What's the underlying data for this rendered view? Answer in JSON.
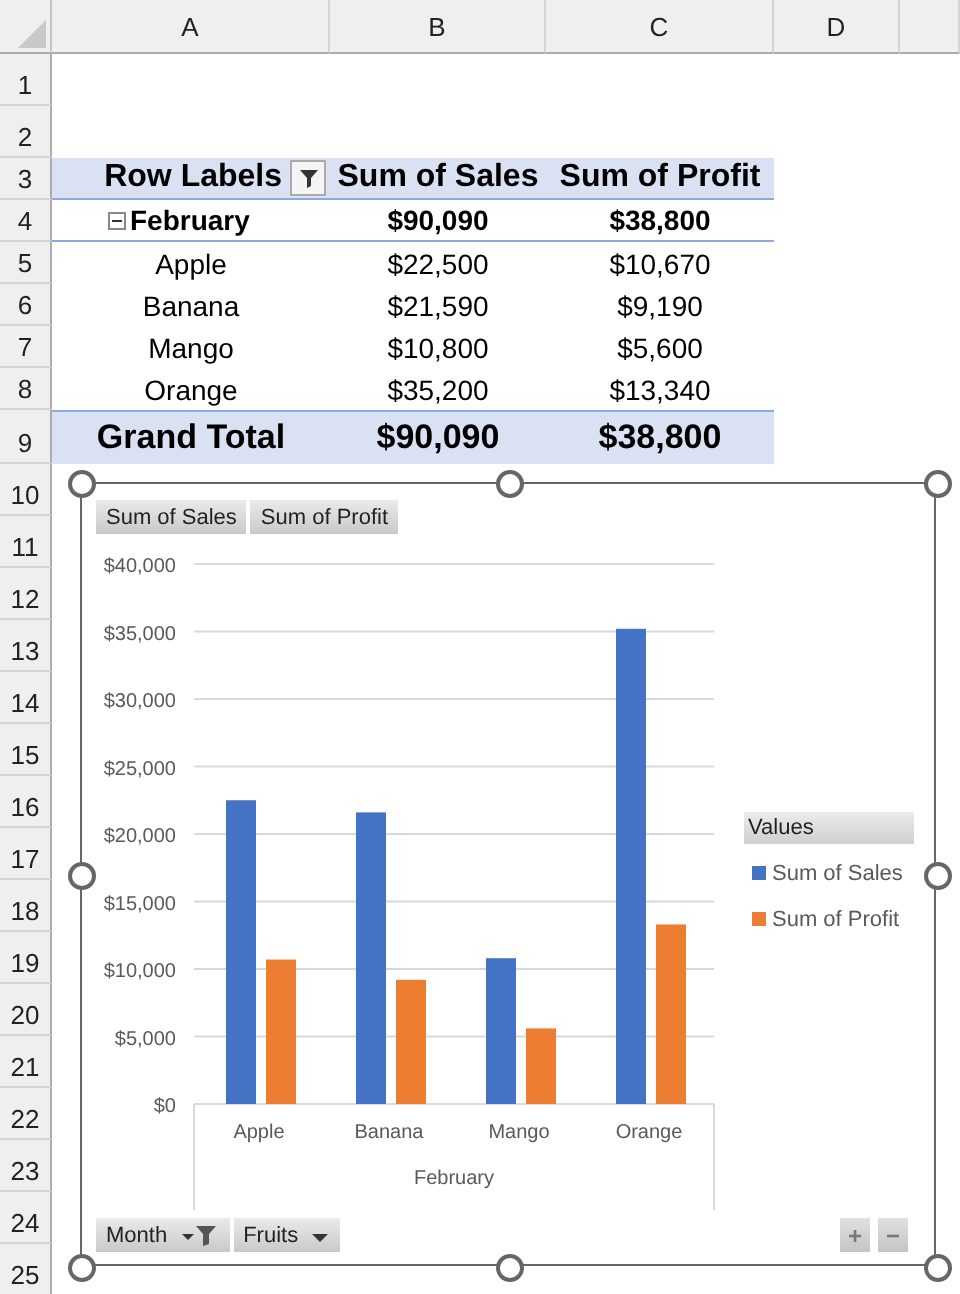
{
  "columns": [
    "A",
    "B",
    "C",
    "D"
  ],
  "rows": [
    "1",
    "2",
    "3",
    "4",
    "5",
    "6",
    "7",
    "8",
    "9",
    "10",
    "11",
    "12",
    "13",
    "14",
    "15",
    "16",
    "17",
    "18",
    "19",
    "20",
    "21",
    "22",
    "23",
    "24",
    "25"
  ],
  "pivot_table": {
    "header": {
      "row_labels": "Row Labels",
      "filtered": true,
      "col_1": "Sum of Sales",
      "col_2": "Sum of Profit"
    },
    "group": {
      "label": "February",
      "expanded": true,
      "sales": "$90,090",
      "profit": "$38,800"
    },
    "items": [
      {
        "label": "Apple",
        "sales": "$22,500",
        "profit": "$10,670"
      },
      {
        "label": "Banana",
        "sales": "$21,590",
        "profit": "$9,190"
      },
      {
        "label": "Mango",
        "sales": "$10,800",
        "profit": "$5,600"
      },
      {
        "label": "Orange",
        "sales": "$35,200",
        "profit": "$13,340"
      }
    ],
    "grand_total": {
      "label": "Grand Total",
      "sales": "$90,090",
      "profit": "$38,800"
    }
  },
  "pivot_chart": {
    "value_buttons": [
      "Sum of Sales",
      "Sum of Profit"
    ],
    "axis_buttons": [
      {
        "label": "Month",
        "filtered": true
      },
      {
        "label": "Fruits",
        "filtered": false
      }
    ],
    "legend_title": "Values",
    "zoom_buttons": [
      "+",
      "−"
    ],
    "chart_data": {
      "type": "bar",
      "xlabel": "February",
      "categories": [
        "Apple",
        "Banana",
        "Mango",
        "Orange"
      ],
      "series": [
        {
          "name": "Sum of Sales",
          "color": "#4472c4",
          "values": [
            22500,
            21600,
            10800,
            35200
          ]
        },
        {
          "name": "Sum of Profit",
          "color": "#ed7d31",
          "values": [
            10700,
            9200,
            5600,
            13300
          ]
        }
      ],
      "grid": true,
      "ylim": [
        0,
        40000
      ],
      "yticks": [
        {
          "value": 0,
          "label": "$0"
        },
        {
          "value": 5000,
          "label": "$5,000"
        },
        {
          "value": 10000,
          "label": "$10,000"
        },
        {
          "value": 15000,
          "label": "$15,000"
        },
        {
          "value": 20000,
          "label": "$20,000"
        },
        {
          "value": 25000,
          "label": "$25,000"
        },
        {
          "value": 30000,
          "label": "$30,000"
        },
        {
          "value": 35000,
          "label": "$35,000"
        },
        {
          "value": 40000,
          "label": "$40,000"
        }
      ]
    }
  }
}
